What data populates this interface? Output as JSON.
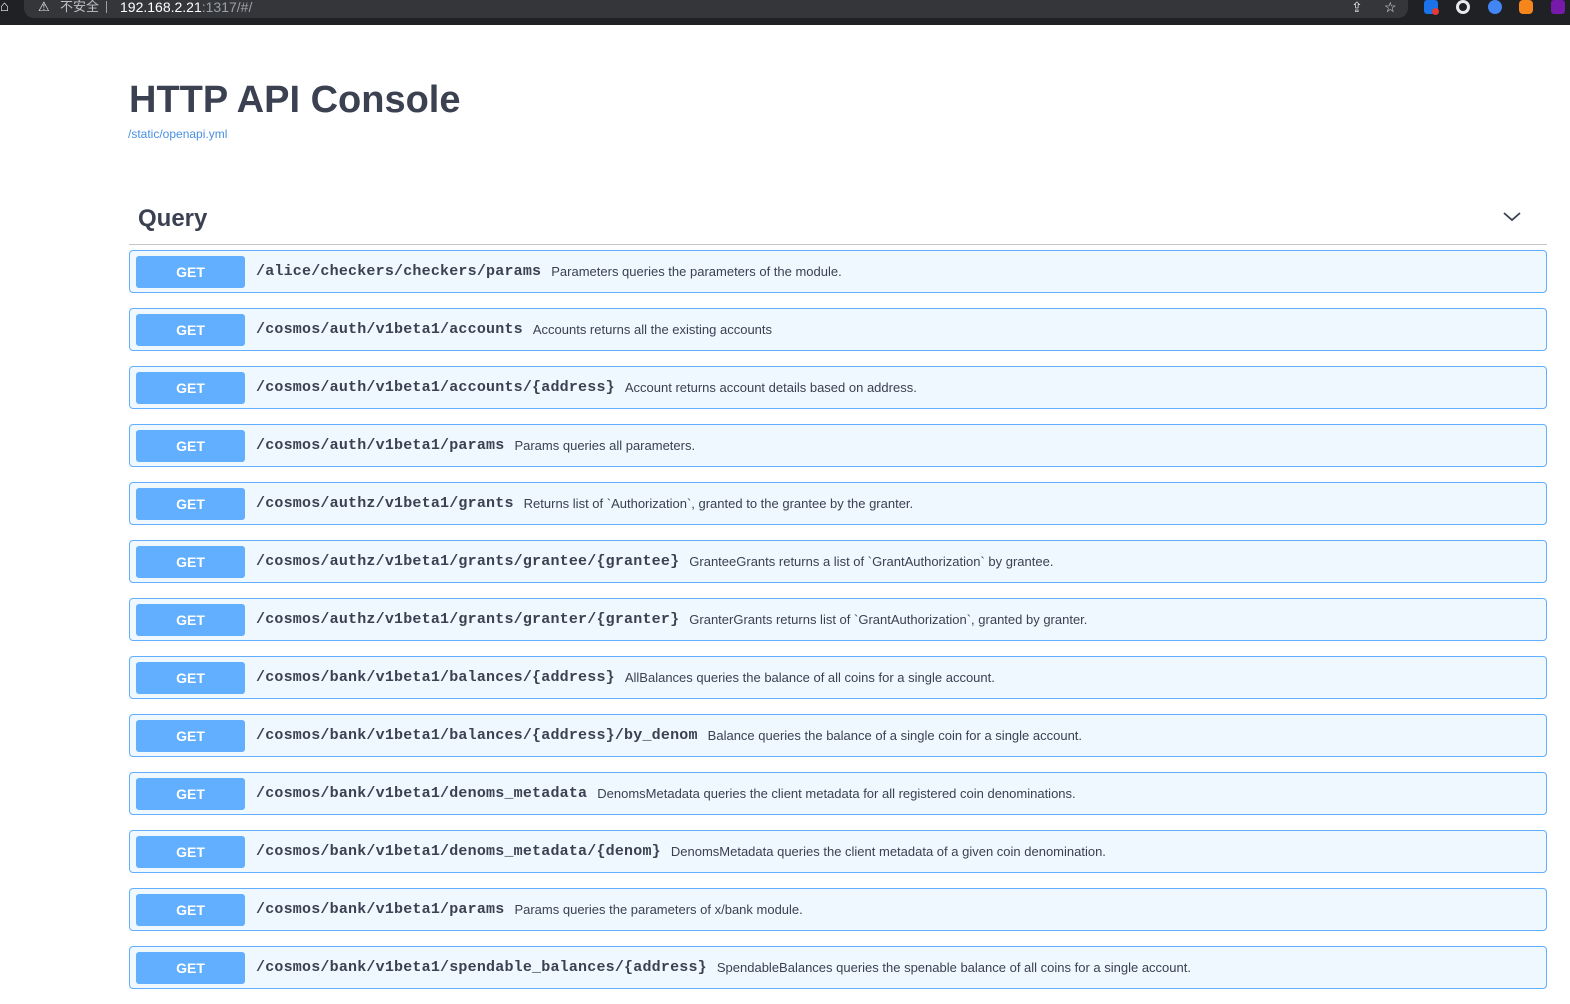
{
  "browser": {
    "insecure_label": "不安全",
    "url_host": "192.168.2.21",
    "url_path": ":1317/#/"
  },
  "page": {
    "title": "HTTP API Console",
    "spec_link": "/static/openapi.yml"
  },
  "tag": {
    "name": "Query"
  },
  "operations": [
    {
      "method": "GET",
      "path": "/alice/checkers/checkers/params",
      "desc": "Parameters queries the parameters of the module."
    },
    {
      "method": "GET",
      "path": "/cosmos/auth/v1beta1/accounts",
      "desc": "Accounts returns all the existing accounts"
    },
    {
      "method": "GET",
      "path": "/cosmos/auth/v1beta1/accounts/{address}",
      "desc": "Account returns account details based on address."
    },
    {
      "method": "GET",
      "path": "/cosmos/auth/v1beta1/params",
      "desc": "Params queries all parameters."
    },
    {
      "method": "GET",
      "path": "/cosmos/authz/v1beta1/grants",
      "desc": "Returns list of `Authorization`, granted to the grantee by the granter."
    },
    {
      "method": "GET",
      "path": "/cosmos/authz/v1beta1/grants/grantee/{grantee}",
      "desc": "GranteeGrants returns a list of `GrantAuthorization` by grantee."
    },
    {
      "method": "GET",
      "path": "/cosmos/authz/v1beta1/grants/granter/{granter}",
      "desc": "GranterGrants returns list of `GrantAuthorization`, granted by granter."
    },
    {
      "method": "GET",
      "path": "/cosmos/bank/v1beta1/balances/{address}",
      "desc": "AllBalances queries the balance of all coins for a single account."
    },
    {
      "method": "GET",
      "path": "/cosmos/bank/v1beta1/balances/{address}/by_denom",
      "desc": "Balance queries the balance of a single coin for a single account."
    },
    {
      "method": "GET",
      "path": "/cosmos/bank/v1beta1/denoms_metadata",
      "desc": "DenomsMetadata queries the client metadata for all registered coin denominations."
    },
    {
      "method": "GET",
      "path": "/cosmos/bank/v1beta1/denoms_metadata/{denom}",
      "desc": "DenomsMetadata queries the client metadata of a given coin denomination."
    },
    {
      "method": "GET",
      "path": "/cosmos/bank/v1beta1/params",
      "desc": "Params queries the parameters of x/bank module."
    },
    {
      "method": "GET",
      "path": "/cosmos/bank/v1beta1/spendable_balances/{address}",
      "desc": "SpendableBalances queries the spenable balance of all coins for a single account."
    }
  ],
  "colors": {
    "get_method": "#61affe",
    "text": "#3b4151",
    "link": "#4990e2"
  }
}
